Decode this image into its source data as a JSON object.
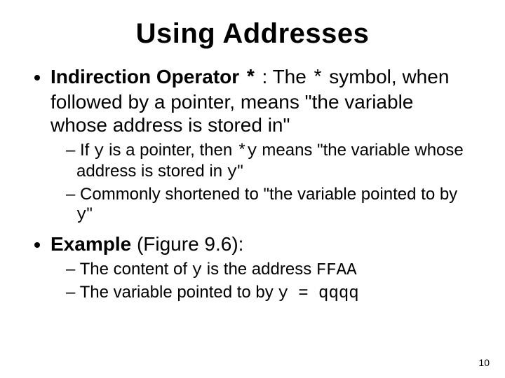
{
  "title": "Using Addresses",
  "bullets": {
    "b1": {
      "strong": "Indirection Operator ",
      "codeA": "*",
      "mid": " :  The ",
      "codeB": "*",
      "rest": " symbol, when followed by a pointer, means \"the variable whose address is stored in\""
    },
    "b1subs": {
      "s1": {
        "a": "If ",
        "y1": "y",
        "b": " is a pointer, then ",
        "stary": "*y",
        "c": " means \"the variable whose address is stored in ",
        "y2": "y",
        "d": "\""
      },
      "s2": {
        "a": "Commonly shortened to \"the variable pointed to by ",
        "y": "y",
        "b": "\""
      }
    },
    "b2": {
      "strong": "Example",
      "rest": " (Figure 9.6):"
    },
    "b2subs": {
      "s1": {
        "a": "The content of ",
        "y": "y",
        "b": " is the address ",
        "addr": "FFAA"
      },
      "s2": {
        "a": "The variable pointed to by ",
        "expr": "y = qqqq"
      }
    }
  },
  "page_number": "10"
}
